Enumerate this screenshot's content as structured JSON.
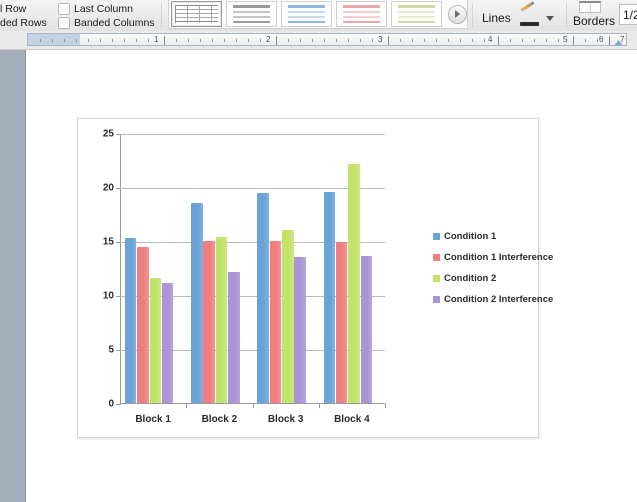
{
  "ribbon": {
    "checkboxes": [
      {
        "label": "l Row",
        "checked": false
      },
      {
        "label": "ded Rows",
        "checked": false
      },
      {
        "label": "Last Column",
        "checked": false
      },
      {
        "label": "Banded Columns",
        "checked": false
      }
    ],
    "gallery": {
      "name": "table-styles-gallery",
      "items": [
        {
          "name": "table-style-plain",
          "accent": "#8a8a8a",
          "selected": true
        },
        {
          "name": "table-style-gray",
          "accent": "#9a9a9a",
          "selected": false
        },
        {
          "name": "table-style-blue",
          "accent": "#8fb4dd",
          "selected": false
        },
        {
          "name": "table-style-red",
          "accent": "#e8a7a7",
          "selected": false
        },
        {
          "name": "table-style-green",
          "accent": "#cdd9a2",
          "selected": false
        }
      ],
      "more_label": "More"
    },
    "lines_label": "Lines",
    "borders_label": "Borders",
    "line_weight_value": "1/2"
  },
  "ruler": {
    "unit_marks": [
      "1",
      "2",
      "3",
      "4",
      "5",
      "6",
      "7"
    ],
    "left_indent_position": "0.5",
    "right_indent_position": "7"
  },
  "chart": {
    "name": "embedded-bar-chart"
  },
  "chart_data": {
    "type": "bar",
    "title": "",
    "subtitle": "",
    "xlabel": "",
    "ylabel": "",
    "categories": [
      "Block 1",
      "Block 2",
      "Block 3",
      "Block 4"
    ],
    "series": [
      {
        "name": "Condition 1",
        "color": "#6aa3d8",
        "values": [
          15.3,
          18.5,
          19.4,
          19.5
        ]
      },
      {
        "name": "Condition 1 Interference",
        "color": "#ef7f7f",
        "values": [
          14.4,
          15.0,
          15.0,
          14.9
        ]
      },
      {
        "name": "Condition 2",
        "color": "#c2e36a",
        "values": [
          11.6,
          15.4,
          16.0,
          22.1
        ]
      },
      {
        "name": "Condition 2 Interference",
        "color": "#a994d6",
        "values": [
          11.1,
          12.1,
          13.5,
          13.6
        ]
      }
    ],
    "ylim": [
      0,
      25
    ],
    "yticks": [
      0,
      5,
      10,
      15,
      20,
      25
    ],
    "ytick_labels": [
      "0",
      "5",
      "10",
      "15",
      "20",
      "25"
    ],
    "grid": true,
    "legend_position": "right"
  }
}
